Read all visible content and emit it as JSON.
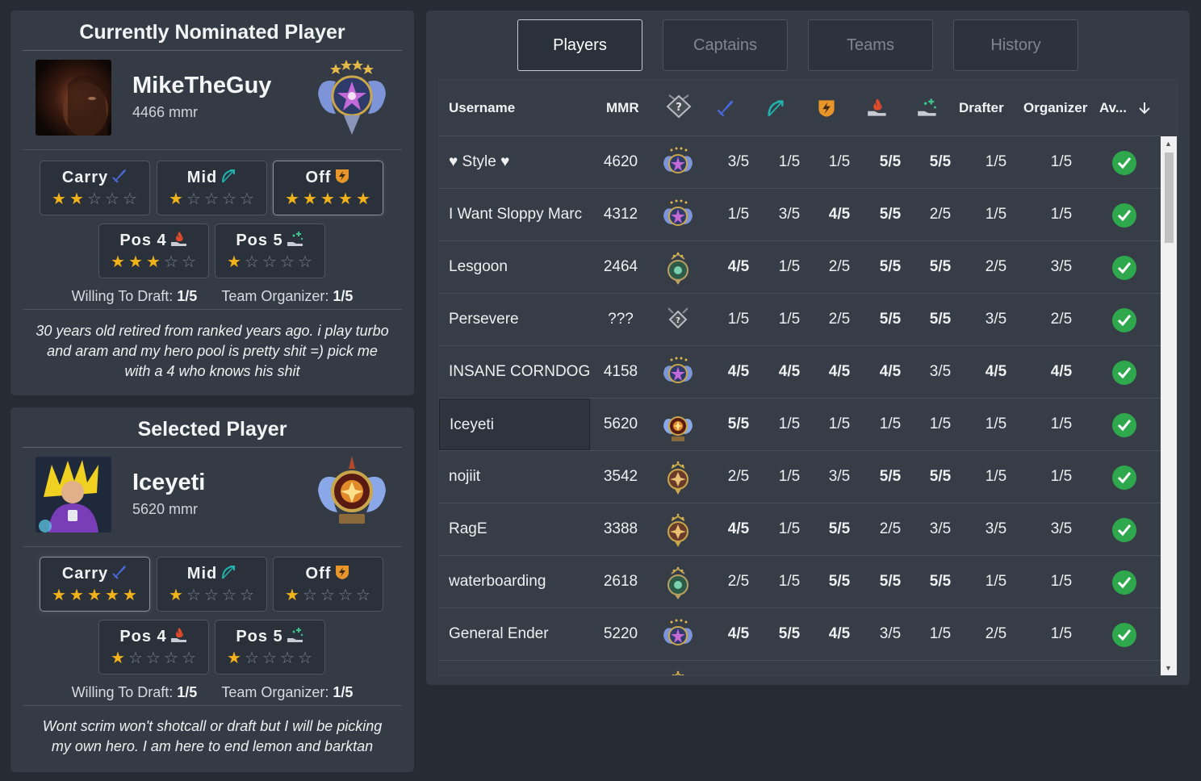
{
  "nominated": {
    "title": "Currently Nominated Player",
    "name": "MikeTheGuy",
    "mmr": "4466 mmr",
    "roles": [
      {
        "label": "Carry",
        "stars": 2,
        "icon": "sword-icon"
      },
      {
        "label": "Mid",
        "stars": 1,
        "icon": "bow-icon"
      },
      {
        "label": "Off",
        "stars": 5,
        "icon": "lightning-shield-icon"
      },
      {
        "label": "Pos 4",
        "stars": 3,
        "icon": "fire-hand-icon"
      },
      {
        "label": "Pos 5",
        "stars": 1,
        "icon": "healing-hand-icon"
      }
    ],
    "draft_label": "Willing To Draft:",
    "draft_value": "1/5",
    "org_label": "Team Organizer:",
    "org_value": "1/5",
    "bio": "30 years old retired from ranked years ago. i play turbo and aram and my hero pool is pretty shit =) pick me with a 4 who knows his shit"
  },
  "selected": {
    "title": "Selected Player",
    "name": "Iceyeti",
    "mmr": "5620 mmr",
    "roles": [
      {
        "label": "Carry",
        "stars": 5,
        "icon": "sword-icon"
      },
      {
        "label": "Mid",
        "stars": 1,
        "icon": "bow-icon"
      },
      {
        "label": "Off",
        "stars": 1,
        "icon": "lightning-shield-icon"
      },
      {
        "label": "Pos 4",
        "stars": 1,
        "icon": "fire-hand-icon"
      },
      {
        "label": "Pos 5",
        "stars": 1,
        "icon": "healing-hand-icon"
      }
    ],
    "draft_label": "Willing To Draft:",
    "draft_value": "1/5",
    "org_label": "Team Organizer:",
    "org_value": "1/5",
    "bio": "Wont scrim won't shotcall or draft but I will be picking my own hero. I am here to end lemon and barktan"
  },
  "tabs": [
    "Players",
    "Captains",
    "Teams",
    "History"
  ],
  "active_tab": "Players",
  "table": {
    "headers": {
      "username": "Username",
      "mmr": "MMR",
      "drafter": "Drafter",
      "organizer": "Organizer",
      "available": "Av...",
      "sort_icon": "arrow-down-icon"
    },
    "rows": [
      {
        "username": "♥ Style ♥",
        "mmr": "4620",
        "rank": "divine",
        "vals": [
          "3/5",
          "1/5",
          "1/5",
          "5/5",
          "5/5",
          "1/5",
          "1/5"
        ],
        "available": true
      },
      {
        "username": "I Want Sloppy Marc",
        "mmr": "4312",
        "rank": "divine",
        "vals": [
          "1/5",
          "3/5",
          "4/5",
          "5/5",
          "2/5",
          "1/5",
          "1/5"
        ],
        "available": true
      },
      {
        "username": "Lesgoon",
        "mmr": "2464",
        "rank": "legend",
        "vals": [
          "4/5",
          "1/5",
          "2/5",
          "5/5",
          "5/5",
          "2/5",
          "3/5"
        ],
        "available": true
      },
      {
        "username": "Persevere",
        "mmr": "???",
        "rank": "unranked",
        "vals": [
          "1/5",
          "1/5",
          "2/5",
          "5/5",
          "5/5",
          "3/5",
          "2/5"
        ],
        "available": true
      },
      {
        "username": "INSANE CORNDOG",
        "mmr": "4158",
        "rank": "divine",
        "vals": [
          "4/5",
          "4/5",
          "4/5",
          "4/5",
          "3/5",
          "4/5",
          "4/5"
        ],
        "available": true
      },
      {
        "username": "Iceyeti",
        "mmr": "5620",
        "rank": "immortal",
        "vals": [
          "5/5",
          "1/5",
          "1/5",
          "1/5",
          "1/5",
          "1/5",
          "1/5"
        ],
        "available": true,
        "selected": true
      },
      {
        "username": "nojiit",
        "mmr": "3542",
        "rank": "ancient",
        "vals": [
          "2/5",
          "1/5",
          "3/5",
          "5/5",
          "5/5",
          "1/5",
          "1/5"
        ],
        "available": true
      },
      {
        "username": "RagE",
        "mmr": "3388",
        "rank": "ancient",
        "vals": [
          "4/5",
          "1/5",
          "5/5",
          "2/5",
          "3/5",
          "3/5",
          "3/5"
        ],
        "available": true
      },
      {
        "username": "waterboarding",
        "mmr": "2618",
        "rank": "legend",
        "vals": [
          "2/5",
          "1/5",
          "5/5",
          "5/5",
          "5/5",
          "1/5",
          "1/5"
        ],
        "available": true
      },
      {
        "username": "General Ender",
        "mmr": "5220",
        "rank": "divine",
        "vals": [
          "4/5",
          "5/5",
          "4/5",
          "3/5",
          "1/5",
          "2/5",
          "1/5"
        ],
        "available": true
      },
      {
        "username": "",
        "mmr": "",
        "rank": "ancient",
        "vals": [
          "",
          "",
          "",
          "",
          "",
          "",
          ""
        ],
        "available": true
      }
    ]
  },
  "colors": {
    "star_on": "#f2b21a",
    "check": "#2fa74d",
    "carry_icon": "#4a68d8",
    "mid_icon": "#1fb5b0",
    "off_icon": "#e8962a",
    "pos4_icon": "#e04a2a",
    "pos5_icon": "#3ec48a"
  }
}
